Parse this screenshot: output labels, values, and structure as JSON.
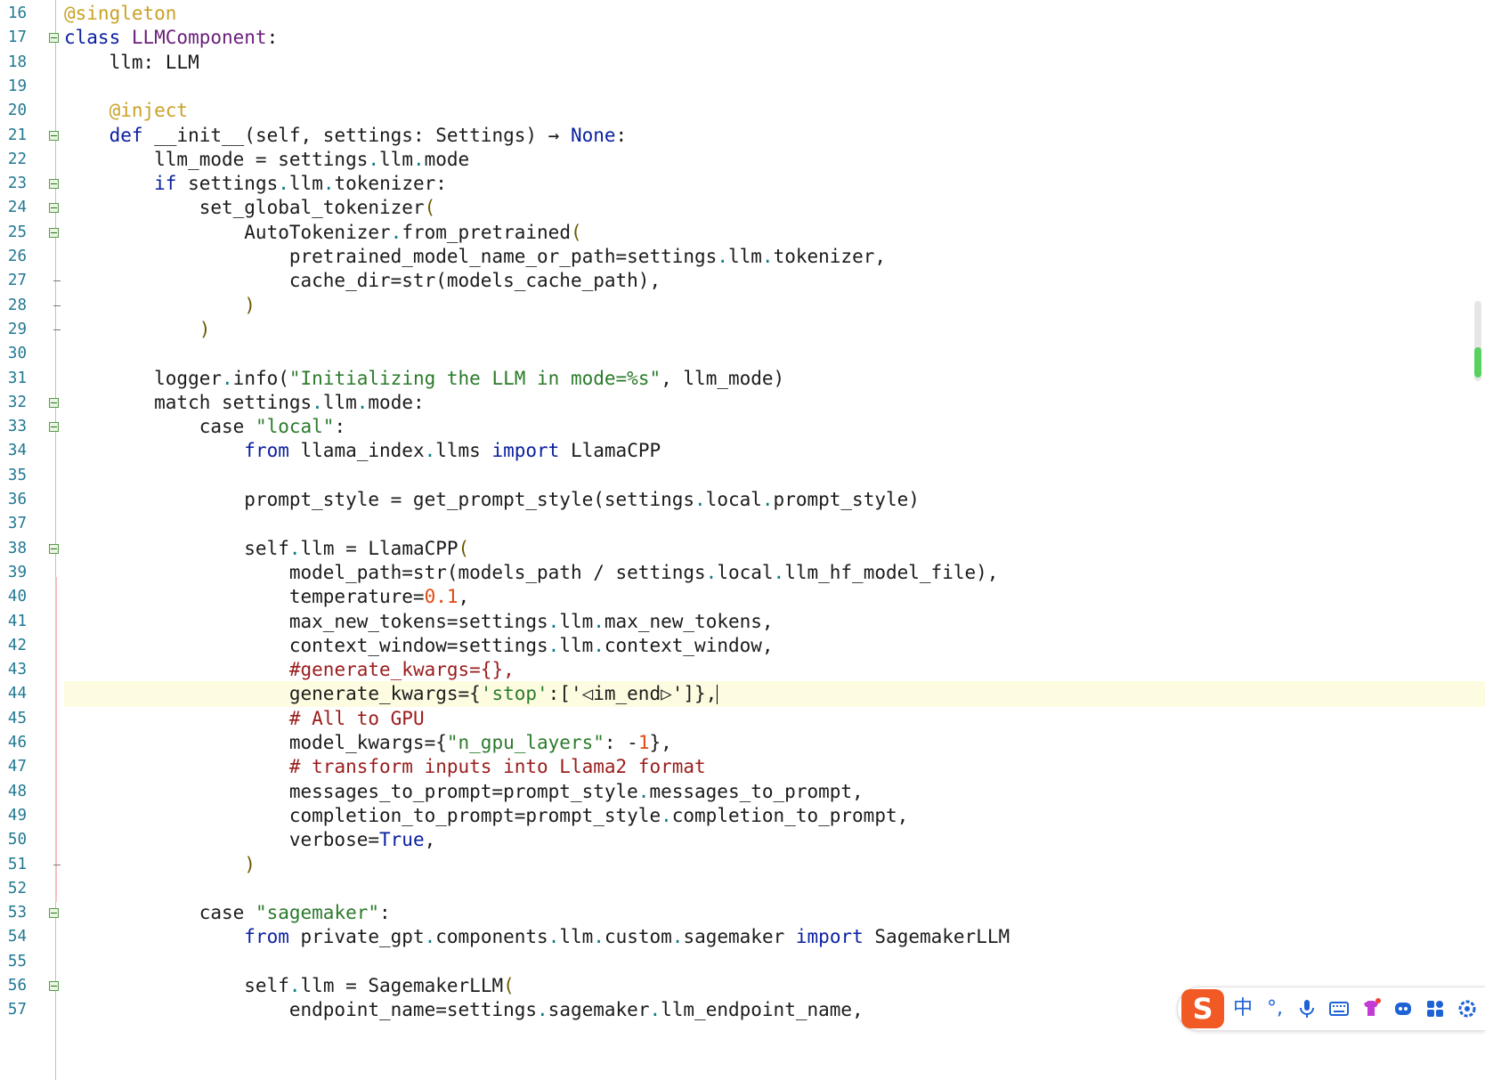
{
  "editor": {
    "lines": [
      {
        "n": "16",
        "fold": "",
        "segs": [
          [
            "dec",
            "@singleton"
          ]
        ]
      },
      {
        "n": "17",
        "fold": "open",
        "segs": [
          [
            "kw",
            "class "
          ],
          [
            "cls",
            "LLMComponent"
          ],
          [
            "op",
            ":"
          ]
        ]
      },
      {
        "n": "18",
        "fold": "",
        "segs": [
          [
            "op",
            "    llm: LLM"
          ]
        ]
      },
      {
        "n": "19",
        "fold": "",
        "segs": []
      },
      {
        "n": "20",
        "fold": "",
        "segs": [
          [
            "op",
            "    "
          ],
          [
            "dec",
            "@inject"
          ]
        ]
      },
      {
        "n": "21",
        "fold": "open",
        "segs": [
          [
            "op",
            "    "
          ],
          [
            "kw",
            "def "
          ],
          [
            "op",
            "__init__(self, settings: Settings) → "
          ],
          [
            "kw",
            "None"
          ],
          [
            "op",
            ":"
          ]
        ]
      },
      {
        "n": "22",
        "fold": "",
        "segs": [
          [
            "op",
            "        llm_mode = settings"
          ],
          [
            "dot",
            "."
          ],
          [
            "op",
            "llm"
          ],
          [
            "dot",
            "."
          ],
          [
            "op",
            "mode"
          ]
        ]
      },
      {
        "n": "23",
        "fold": "open",
        "segs": [
          [
            "op",
            "        "
          ],
          [
            "kw",
            "if "
          ],
          [
            "op",
            "settings"
          ],
          [
            "dot",
            "."
          ],
          [
            "op",
            "llm"
          ],
          [
            "dot",
            "."
          ],
          [
            "op",
            "tokenizer:"
          ]
        ]
      },
      {
        "n": "24",
        "fold": "open",
        "segs": [
          [
            "op",
            "            set_global_tokenizer"
          ],
          [
            "pn",
            "("
          ]
        ]
      },
      {
        "n": "25",
        "fold": "open",
        "segs": [
          [
            "op",
            "                AutoTokenizer"
          ],
          [
            "dot",
            "."
          ],
          [
            "op",
            "from_pretrained"
          ],
          [
            "pn",
            "("
          ]
        ]
      },
      {
        "n": "26",
        "fold": "",
        "segs": [
          [
            "op",
            "                    pretrained_model_name_or_path=settings"
          ],
          [
            "dot",
            "."
          ],
          [
            "op",
            "llm"
          ],
          [
            "dot",
            "."
          ],
          [
            "op",
            "tokenizer,"
          ]
        ]
      },
      {
        "n": "27",
        "fold": "end",
        "segs": [
          [
            "op",
            "                    cache_dir=str(models_cache_path),"
          ]
        ]
      },
      {
        "n": "28",
        "fold": "end",
        "segs": [
          [
            "op",
            "                "
          ],
          [
            "pn",
            ")"
          ]
        ]
      },
      {
        "n": "29",
        "fold": "end",
        "segs": [
          [
            "op",
            "            "
          ],
          [
            "pn",
            ")"
          ]
        ]
      },
      {
        "n": "30",
        "fold": "",
        "segs": []
      },
      {
        "n": "31",
        "fold": "",
        "segs": [
          [
            "op",
            "        logger"
          ],
          [
            "dot",
            "."
          ],
          [
            "op",
            "info("
          ],
          [
            "str",
            "\"Initializing the LLM in mode=%s\""
          ],
          [
            "op",
            ", llm_mode)"
          ]
        ]
      },
      {
        "n": "32",
        "fold": "open",
        "segs": [
          [
            "op",
            "        match settings"
          ],
          [
            "dot",
            "."
          ],
          [
            "op",
            "llm"
          ],
          [
            "dot",
            "."
          ],
          [
            "op",
            "mode:"
          ]
        ]
      },
      {
        "n": "33",
        "fold": "open",
        "segs": [
          [
            "op",
            "            case "
          ],
          [
            "str",
            "\"local\""
          ],
          [
            "op",
            ":"
          ]
        ]
      },
      {
        "n": "34",
        "fold": "",
        "segs": [
          [
            "op",
            "                "
          ],
          [
            "kw",
            "from "
          ],
          [
            "op",
            "llama_index"
          ],
          [
            "dot",
            "."
          ],
          [
            "op",
            "llms "
          ],
          [
            "kw",
            "import "
          ],
          [
            "op",
            "LlamaCPP"
          ]
        ]
      },
      {
        "n": "35",
        "fold": "",
        "segs": []
      },
      {
        "n": "36",
        "fold": "",
        "segs": [
          [
            "op",
            "                prompt_style = get_prompt_style(settings"
          ],
          [
            "dot",
            "."
          ],
          [
            "op",
            "local"
          ],
          [
            "dot",
            "."
          ],
          [
            "op",
            "prompt_style)"
          ]
        ]
      },
      {
        "n": "37",
        "fold": "",
        "segs": []
      },
      {
        "n": "38",
        "fold": "open",
        "segs": [
          [
            "op",
            "                self"
          ],
          [
            "dot",
            "."
          ],
          [
            "op",
            "llm = LlamaCPP"
          ],
          [
            "pn",
            "("
          ]
        ]
      },
      {
        "n": "39",
        "fold": "",
        "segs": [
          [
            "op",
            "                    model_path=str(models_path / settings"
          ],
          [
            "dot",
            "."
          ],
          [
            "op",
            "local"
          ],
          [
            "dot",
            "."
          ],
          [
            "op",
            "llm_hf_model_file),"
          ]
        ]
      },
      {
        "n": "40",
        "fold": "",
        "segs": [
          [
            "op",
            "                    temperature="
          ],
          [
            "num",
            "0.1"
          ],
          [
            "op",
            ","
          ]
        ]
      },
      {
        "n": "41",
        "fold": "",
        "segs": [
          [
            "op",
            "                    max_new_tokens=settings"
          ],
          [
            "dot",
            "."
          ],
          [
            "op",
            "llm"
          ],
          [
            "dot",
            "."
          ],
          [
            "op",
            "max_new_tokens,"
          ]
        ]
      },
      {
        "n": "42",
        "fold": "",
        "segs": [
          [
            "op",
            "                    context_window=settings"
          ],
          [
            "dot",
            "."
          ],
          [
            "op",
            "llm"
          ],
          [
            "dot",
            "."
          ],
          [
            "op",
            "context_window,"
          ]
        ]
      },
      {
        "n": "43",
        "fold": "",
        "segs": [
          [
            "op",
            "                    "
          ],
          [
            "cmt",
            "#generate_kwargs={},"
          ]
        ]
      },
      {
        "n": "44",
        "fold": "",
        "current": true,
        "segs": [
          [
            "op",
            "                    generate_kwargs={"
          ],
          [
            "str",
            "'stop'"
          ],
          [
            "op",
            ":['◁im_end▷']},"
          ]
        ]
      },
      {
        "n": "45",
        "fold": "",
        "segs": [
          [
            "op",
            "                    "
          ],
          [
            "cmt",
            "# All to GPU"
          ]
        ]
      },
      {
        "n": "46",
        "fold": "",
        "segs": [
          [
            "op",
            "                    model_kwargs={"
          ],
          [
            "str",
            "\"n_gpu_layers\""
          ],
          [
            "op",
            ": -"
          ],
          [
            "num",
            "1"
          ],
          [
            "op",
            "},"
          ]
        ]
      },
      {
        "n": "47",
        "fold": "",
        "segs": [
          [
            "op",
            "                    "
          ],
          [
            "cmt",
            "# transform inputs into Llama2 format"
          ]
        ]
      },
      {
        "n": "48",
        "fold": "",
        "segs": [
          [
            "op",
            "                    messages_to_prompt=prompt_style"
          ],
          [
            "dot",
            "."
          ],
          [
            "op",
            "messages_to_prompt,"
          ]
        ]
      },
      {
        "n": "49",
        "fold": "",
        "segs": [
          [
            "op",
            "                    completion_to_prompt=prompt_style"
          ],
          [
            "dot",
            "."
          ],
          [
            "op",
            "completion_to_prompt,"
          ]
        ]
      },
      {
        "n": "50",
        "fold": "",
        "segs": [
          [
            "op",
            "                    verbose="
          ],
          [
            "kw",
            "True"
          ],
          [
            "op",
            ","
          ]
        ]
      },
      {
        "n": "51",
        "fold": "end",
        "segs": [
          [
            "op",
            "                "
          ],
          [
            "pn",
            ")"
          ]
        ]
      },
      {
        "n": "52",
        "fold": "",
        "segs": []
      },
      {
        "n": "53",
        "fold": "open",
        "segs": [
          [
            "op",
            "            case "
          ],
          [
            "str",
            "\"sagemaker\""
          ],
          [
            "op",
            ":"
          ]
        ]
      },
      {
        "n": "54",
        "fold": "",
        "segs": [
          [
            "op",
            "                "
          ],
          [
            "kw",
            "from "
          ],
          [
            "op",
            "private_gpt"
          ],
          [
            "dot",
            "."
          ],
          [
            "op",
            "components"
          ],
          [
            "dot",
            "."
          ],
          [
            "op",
            "llm"
          ],
          [
            "dot",
            "."
          ],
          [
            "op",
            "custom"
          ],
          [
            "dot",
            "."
          ],
          [
            "op",
            "sagemaker "
          ],
          [
            "kw",
            "import "
          ],
          [
            "op",
            "SagemakerLLM"
          ]
        ]
      },
      {
        "n": "55",
        "fold": "",
        "segs": []
      },
      {
        "n": "56",
        "fold": "open",
        "segs": [
          [
            "op",
            "                self"
          ],
          [
            "dot",
            "."
          ],
          [
            "op",
            "llm = SagemakerLLM"
          ],
          [
            "pn",
            "("
          ]
        ]
      },
      {
        "n": "57",
        "fold": "",
        "segs": [
          [
            "op",
            "                    endpoint_name=settings"
          ],
          [
            "dot",
            "."
          ],
          [
            "op",
            "sagemaker"
          ],
          [
            "dot",
            "."
          ],
          [
            "op",
            "llm_endpoint_name,"
          ]
        ]
      }
    ]
  },
  "ime": {
    "logo": "S",
    "lang": "中",
    "punct": "°,",
    "icons": [
      "microphone-icon",
      "keyboard-icon",
      "skin-icon",
      "emoji-icon",
      "apps-icon",
      "settings-icon"
    ]
  },
  "colors": {
    "keyword": "#0a1fa0",
    "decorator": "#c9a227",
    "string": "#2b7a2b",
    "number": "#e04a12",
    "comment": "#9a1c1c",
    "current_line": "#fdfce0"
  }
}
